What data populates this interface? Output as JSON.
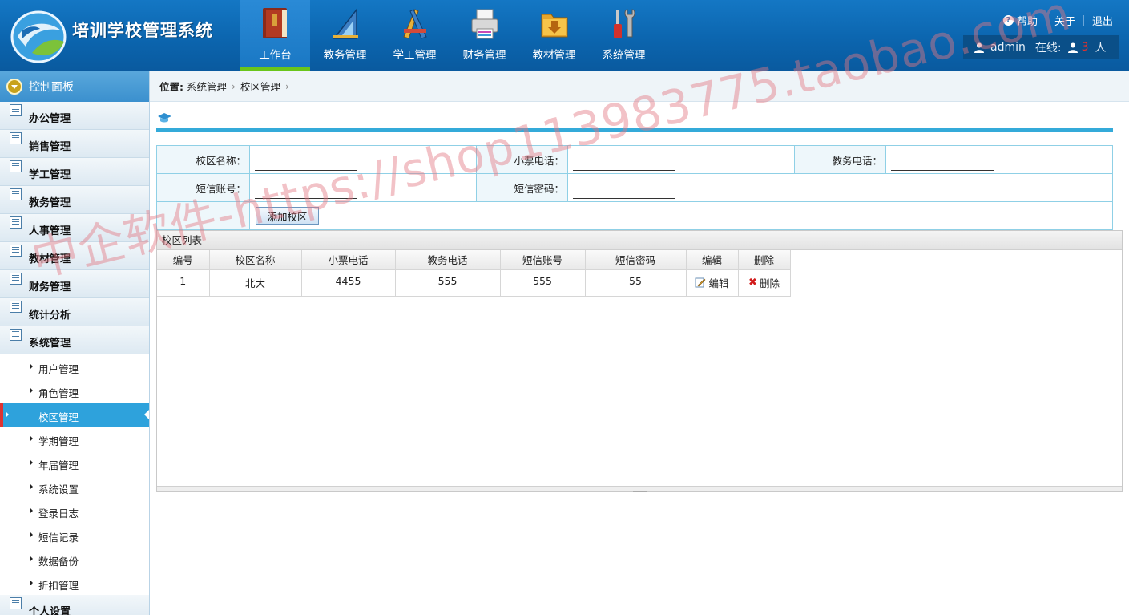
{
  "app": {
    "title": "培训学校管理系统"
  },
  "nav": [
    {
      "label": "工作台",
      "icon": "book-icon",
      "active": true
    },
    {
      "label": "教务管理",
      "icon": "ruler-triangle-icon"
    },
    {
      "label": "学工管理",
      "icon": "pencil-ruler-icon"
    },
    {
      "label": "财务管理",
      "icon": "printer-icon"
    },
    {
      "label": "教材管理",
      "icon": "download-folder-icon"
    },
    {
      "label": "系统管理",
      "icon": "tools-icon"
    }
  ],
  "top_links": {
    "help": "帮助",
    "about": "关于",
    "logout": "退出"
  },
  "user": {
    "name": "admin",
    "online_label": "在线:",
    "online_count": "3",
    "online_unit": "人"
  },
  "sidebar": {
    "panel_title": "控制面板",
    "menus": [
      "办公管理",
      "销售管理",
      "学工管理",
      "教务管理",
      "人事管理",
      "教材管理",
      "财务管理",
      "统计分析",
      "系统管理"
    ],
    "sub_items": [
      "用户管理",
      "角色管理",
      "校区管理",
      "学期管理",
      "年届管理",
      "系统设置",
      "登录日志",
      "短信记录",
      "数据备份",
      "折扣管理"
    ],
    "active_sub": "校区管理",
    "last_menu": "个人设置"
  },
  "breadcrumb": {
    "label": "位置:",
    "level1": "系统管理",
    "level2": "校区管理",
    "sep": "›"
  },
  "form": {
    "campus_name_label": "校区名称：",
    "ticket_phone_label": "小票电话：",
    "academic_phone_label": "教务电话：",
    "sms_account_label": "短信账号：",
    "sms_password_label": "短信密码：",
    "add_button": "添加校区"
  },
  "grid": {
    "title": "校区列表",
    "columns": [
      "编号",
      "校区名称",
      "小票电话",
      "教务电话",
      "短信账号",
      "短信密码",
      "编辑",
      "删除"
    ],
    "rows": [
      {
        "id": "1",
        "name": "北大",
        "ticket_phone": "4455",
        "academic_phone": "555",
        "sms_account": "555",
        "sms_password": "55",
        "edit": "编辑",
        "delete": "删除"
      }
    ]
  },
  "watermark": "中企软件-https://shop113983775.taobao.com",
  "colors": {
    "header_blue": "#0b64ad",
    "accent_cyan": "#34aad9",
    "active_green": "#69c51b",
    "online_red": "#e5302b"
  }
}
